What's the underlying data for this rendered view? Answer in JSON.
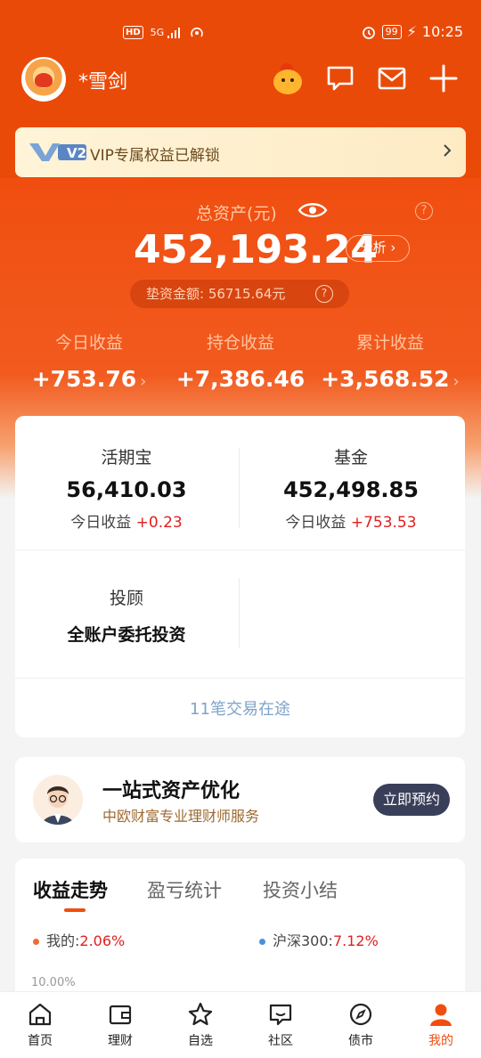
{
  "status_bar": {
    "hd": "HD",
    "signal": "5G",
    "battery": "99",
    "time": "10:25"
  },
  "header": {
    "username": "*雪剑"
  },
  "vip_banner": {
    "logo_text": "V2",
    "text": "VIP专属权益已解锁"
  },
  "assets": {
    "label": "总资产(元)",
    "value": "452,193.24",
    "analyze_label": "分析",
    "pad_label": "垫资金额: 56715.64元",
    "help_symbol": "?"
  },
  "pnl": [
    {
      "label": "今日收益",
      "value": "+753.76",
      "has_chevron": true
    },
    {
      "label": "持仓收益",
      "value": "+7,386.46",
      "has_chevron": false
    },
    {
      "label": "累计收益",
      "value": "+3,568.52",
      "has_chevron": true
    }
  ],
  "holdings": {
    "huoqibao": {
      "title": "活期宝",
      "value": "56,410.03",
      "today_label": "今日收益",
      "today_value": "+0.23"
    },
    "fund": {
      "title": "基金",
      "value": "452,498.85",
      "today_label": "今日收益",
      "today_value": "+753.53"
    },
    "advisory": {
      "title": "投顾",
      "subtitle": "全账户委托投资"
    },
    "in_transit": "11笔交易在途"
  },
  "advisor": {
    "title": "一站式资产优化",
    "subtitle": "中欧财富专业理财师服务",
    "button": "立即预约"
  },
  "trend": {
    "tabs": [
      "收益走势",
      "盈亏统计",
      "投资小结"
    ],
    "mine_label": "我的:",
    "mine_value": "2.06%",
    "index_label": "沪深300:",
    "index_value": "7.12%",
    "y_tick": "10.00%"
  },
  "bottom_nav": [
    "首页",
    "理财",
    "自选",
    "社区",
    "债市",
    "我的"
  ],
  "colors": {
    "brand_orange": "#f04e10",
    "gain_red": "#e02020",
    "mine_dot": "#f26a2e",
    "index_dot": "#4a90e2"
  }
}
